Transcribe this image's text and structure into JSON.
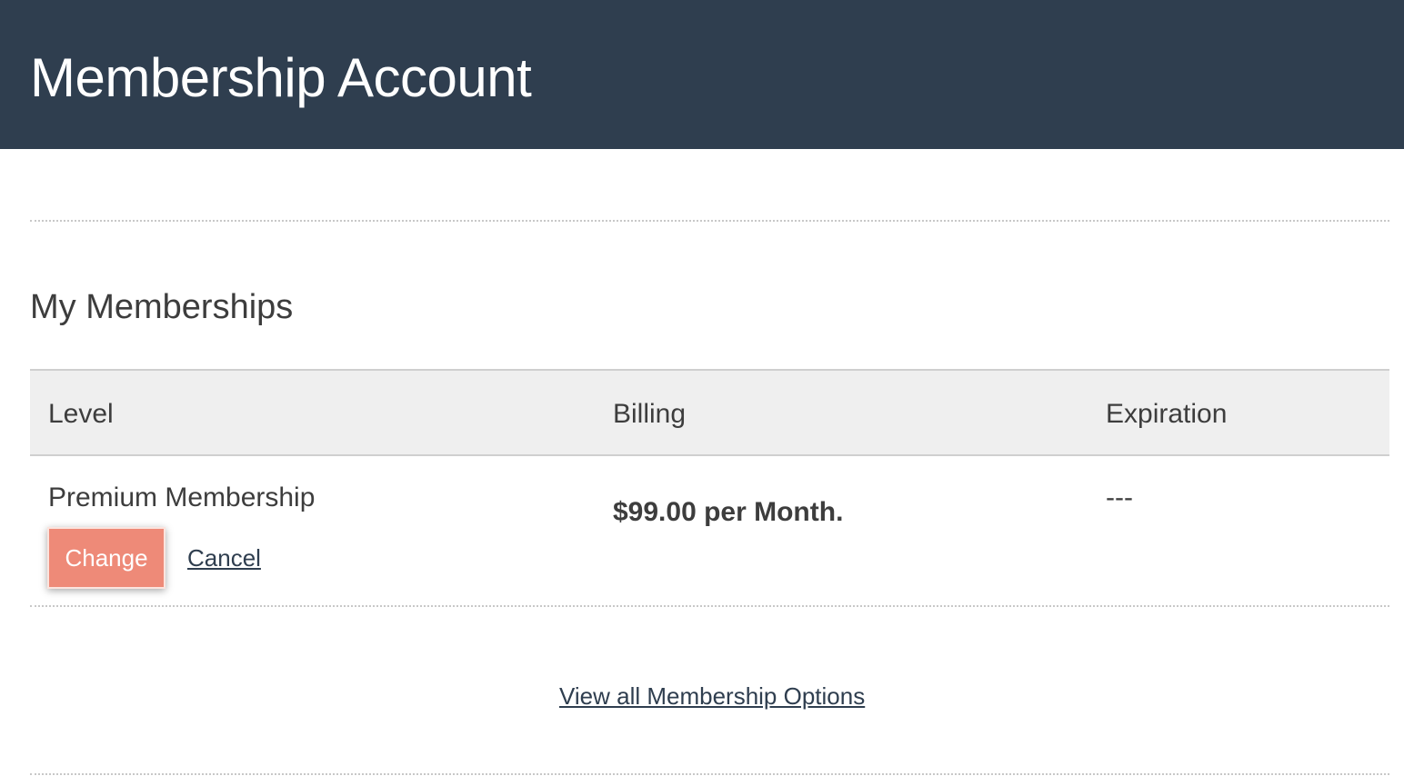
{
  "header": {
    "title": "Membership Account"
  },
  "memberships": {
    "title": "My Memberships",
    "columns": [
      "Level",
      "Billing",
      "Expiration"
    ],
    "rows": [
      {
        "level": "Premium Membership",
        "billing": "$99.00 per Month.",
        "expiration": "---",
        "actions": {
          "change_label": "Change",
          "cancel_label": "Cancel"
        }
      }
    ],
    "view_all_label": "View all Membership Options"
  },
  "colors": {
    "header_bg": "#2f3e4f",
    "change_button_bg": "#ee8a78",
    "table_head_bg": "#efefef",
    "link": "#2f3e4f"
  }
}
